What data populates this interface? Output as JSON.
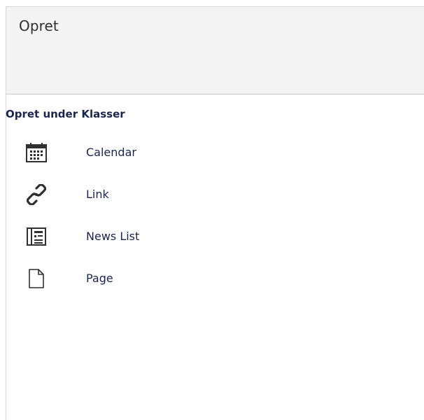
{
  "panel": {
    "title": "Opret"
  },
  "section": {
    "title": "Opret under Klasser"
  },
  "items": [
    {
      "label": "Calendar",
      "icon": "calendar-icon"
    },
    {
      "label": "Link",
      "icon": "link-icon"
    },
    {
      "label": "News List",
      "icon": "news-list-icon"
    },
    {
      "label": "Page",
      "icon": "page-icon"
    }
  ],
  "colors": {
    "header_bg": "#f3f3f5",
    "text": "#1b264f",
    "title_text": "#303033",
    "border": "#c9c8cc"
  }
}
